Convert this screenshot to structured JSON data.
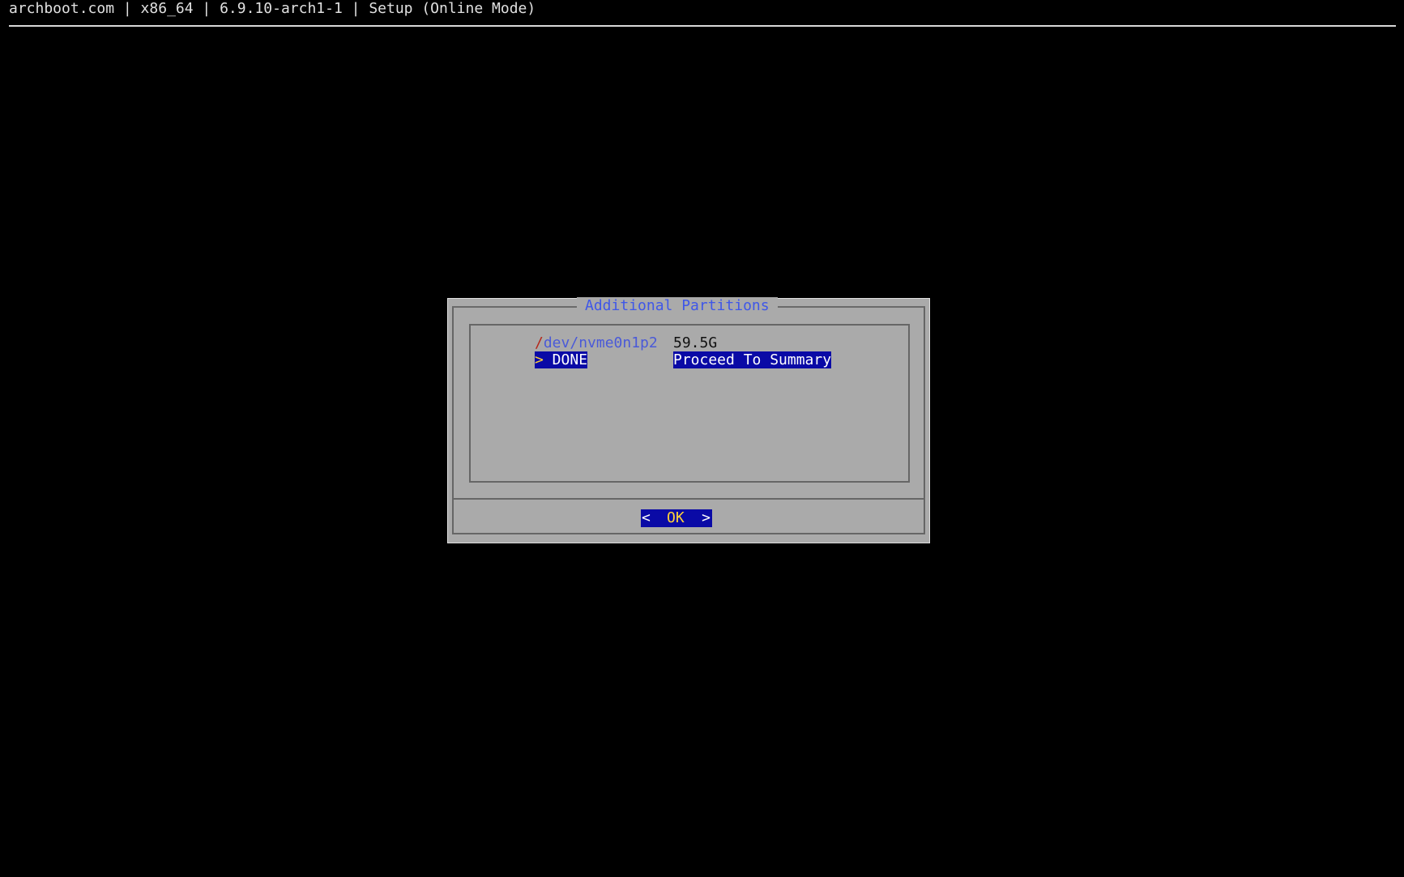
{
  "header": {
    "text": "archboot.com | x86_64 | 6.9.10-arch1-1 | Setup (Online Mode)"
  },
  "dialog": {
    "title": "Additional Partitions",
    "menu": [
      {
        "tag_hot": "/",
        "tag_rest": "dev/nvme0n1p2",
        "item": "59.5G",
        "selected": false
      },
      {
        "tag_hot": ">",
        "tag_rest": " DONE",
        "item": "Proceed To Summary",
        "selected": true
      }
    ],
    "buttons": {
      "ok_left": "<",
      "ok_hot": "O",
      "ok_rest": "K",
      "ok_right": ">"
    }
  },
  "colors": {
    "background": "#000000",
    "dialog_background": "#aaaaaa",
    "title": "#3f57e8",
    "selection": "#0a0aa6",
    "hotkey_selected": "#ffd23a",
    "hotkey": "#b5281b"
  }
}
